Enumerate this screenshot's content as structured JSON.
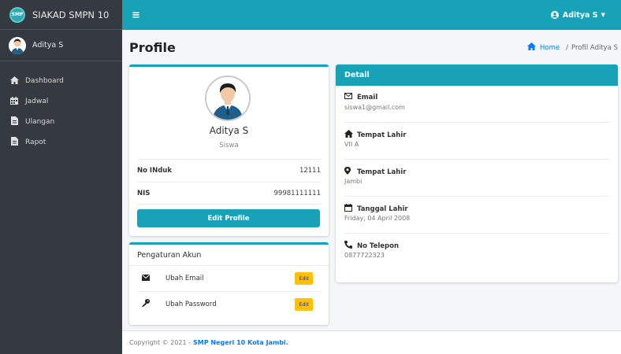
{
  "brand": {
    "logo": "SMP",
    "name": "SIAKAD SMPN 10"
  },
  "sidebar": {
    "user": "Aditya S",
    "items": [
      {
        "icon": "home-icon",
        "label": "Dashboard"
      },
      {
        "icon": "calendar-icon",
        "label": "Jadwal"
      },
      {
        "icon": "file-icon",
        "label": "Ulangan"
      },
      {
        "icon": "file-icon",
        "label": "Rapot"
      }
    ]
  },
  "topbar": {
    "menu": "≡",
    "user": "Aditya S"
  },
  "page": {
    "title": "Profile",
    "breadcrumb": {
      "home": "Home",
      "sep": "/",
      "current": "Profil Aditya S"
    }
  },
  "profile": {
    "name": "Aditya S",
    "role": "Siswa",
    "rows": [
      {
        "label": "No INduk",
        "value": "12111"
      },
      {
        "label": "NIS",
        "value": "99981111111"
      }
    ],
    "edit_label": "Edit Profile"
  },
  "account": {
    "title": "Pengaturan Akun",
    "rows": [
      {
        "icon": "envelope-icon",
        "label": "Ubah Email",
        "button": "Edit"
      },
      {
        "icon": "key-icon",
        "label": "Ubah Password",
        "button": "Edit"
      }
    ]
  },
  "detail": {
    "title": "Detail",
    "items": [
      {
        "icon": "envelope-icon",
        "label": "Email",
        "value": "siswa1@gmail.com"
      },
      {
        "icon": "home-icon",
        "label": "Tempat Lahir",
        "value": "VII A"
      },
      {
        "icon": "map-marker-icon",
        "label": "Tempat Lahir",
        "value": "Jambi"
      },
      {
        "icon": "calendar-icon",
        "label": "Tanggal Lahir",
        "value": "Friday, 04 April 2008"
      },
      {
        "icon": "phone-icon",
        "label": "No Telepon",
        "value": "0877722323"
      }
    ]
  },
  "footer": {
    "text": "Copyright © 2021 -",
    "link": "SMP Negeri 10 Kota Jambi."
  },
  "colors": {
    "accent": "#17a2b8",
    "sidebar": "#343a40",
    "warning": "#ffc107",
    "link": "#007bff"
  }
}
